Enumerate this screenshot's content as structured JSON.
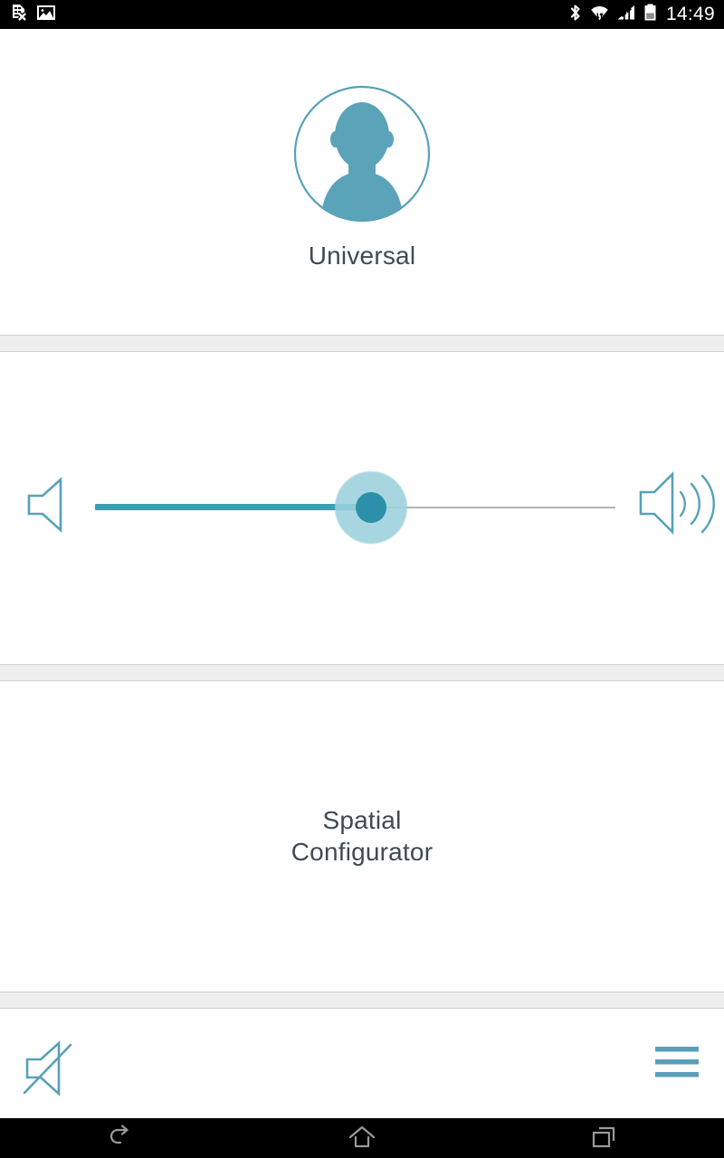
{
  "status_bar": {
    "left_icons": [
      {
        "name": "no-sim-card-icon",
        "label": "No SIM card"
      },
      {
        "name": "image-saved-icon",
        "label": "Screenshot saved"
      }
    ],
    "right_icons": [
      {
        "name": "bluetooth-icon",
        "label": "Bluetooth"
      },
      {
        "name": "wifi-icon",
        "label": "Wi-Fi connected"
      },
      {
        "name": "cellular-signal-icon",
        "label": "Signal strength"
      },
      {
        "name": "battery-icon",
        "label": "Battery"
      }
    ],
    "time": "14:49"
  },
  "profile": {
    "avatar_icon": "person-avatar-icon",
    "name": "Universal"
  },
  "volume": {
    "low_icon": "volume-low-icon",
    "high_icon": "volume-high-icon",
    "value": 53,
    "min": 0,
    "max": 100
  },
  "main": {
    "title_line_1": "Spatial",
    "title_line_2": "Configurator"
  },
  "bottom_bar": {
    "mute_icon": "volume-mute-icon",
    "menu_icon": "hamburger-menu-icon"
  },
  "nav_bar": {
    "back_label": "Back",
    "home_label": "Home",
    "recents_label": "Recent apps"
  },
  "colors": {
    "accent": "#3d9eb4",
    "accent_dark": "#2d90aa",
    "accent_light": "#9bd1de",
    "avatar_fill": "#5ba3b8",
    "text": "#3e4a55",
    "divider_bg": "#eeeeee",
    "divider_border": "#d0d0d0",
    "status_bg": "#000000",
    "track_inactive": "#b4b4b4"
  }
}
